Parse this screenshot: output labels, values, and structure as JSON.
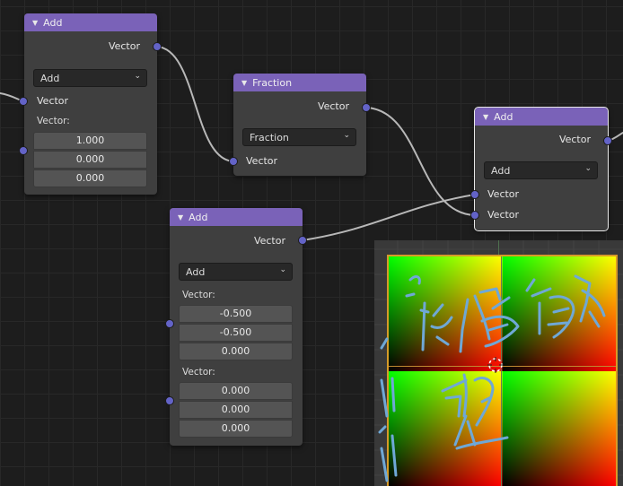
{
  "colors": {
    "header": "#7a62b8",
    "node_body": "#3f3f3f",
    "socket": "#6363c7",
    "link": "#b8b8b8",
    "canvas": "#1d1d1d",
    "viewer_border": "#d89a28"
  },
  "node_add1": {
    "title": "Add",
    "output_label": "Vector",
    "operation": "Add",
    "input_label": "Vector",
    "vector_label": "Vector:",
    "values": [
      "1.000",
      "0.000",
      "0.000"
    ]
  },
  "node_fraction": {
    "title": "Fraction",
    "output_label": "Vector",
    "operation": "Fraction",
    "input_label": "Vector"
  },
  "node_add3": {
    "title": "Add",
    "output_label": "Vector",
    "operation": "Add",
    "input1_label": "Vector",
    "input2_label": "Vector"
  },
  "node_add2": {
    "title": "Add",
    "output_label": "Vector",
    "operation": "Add",
    "vector1_label": "Vector:",
    "vector1_values": [
      "-0.500",
      "-0.500",
      "0.000"
    ],
    "vector2_label": "Vector:",
    "vector2_values": [
      "0.000",
      "0.000",
      "0.000"
    ]
  },
  "icons": {
    "collapse": "collapse-arrow-icon",
    "dropdown": "chevron-down-icon",
    "cursor": "3d-cursor-icon"
  }
}
